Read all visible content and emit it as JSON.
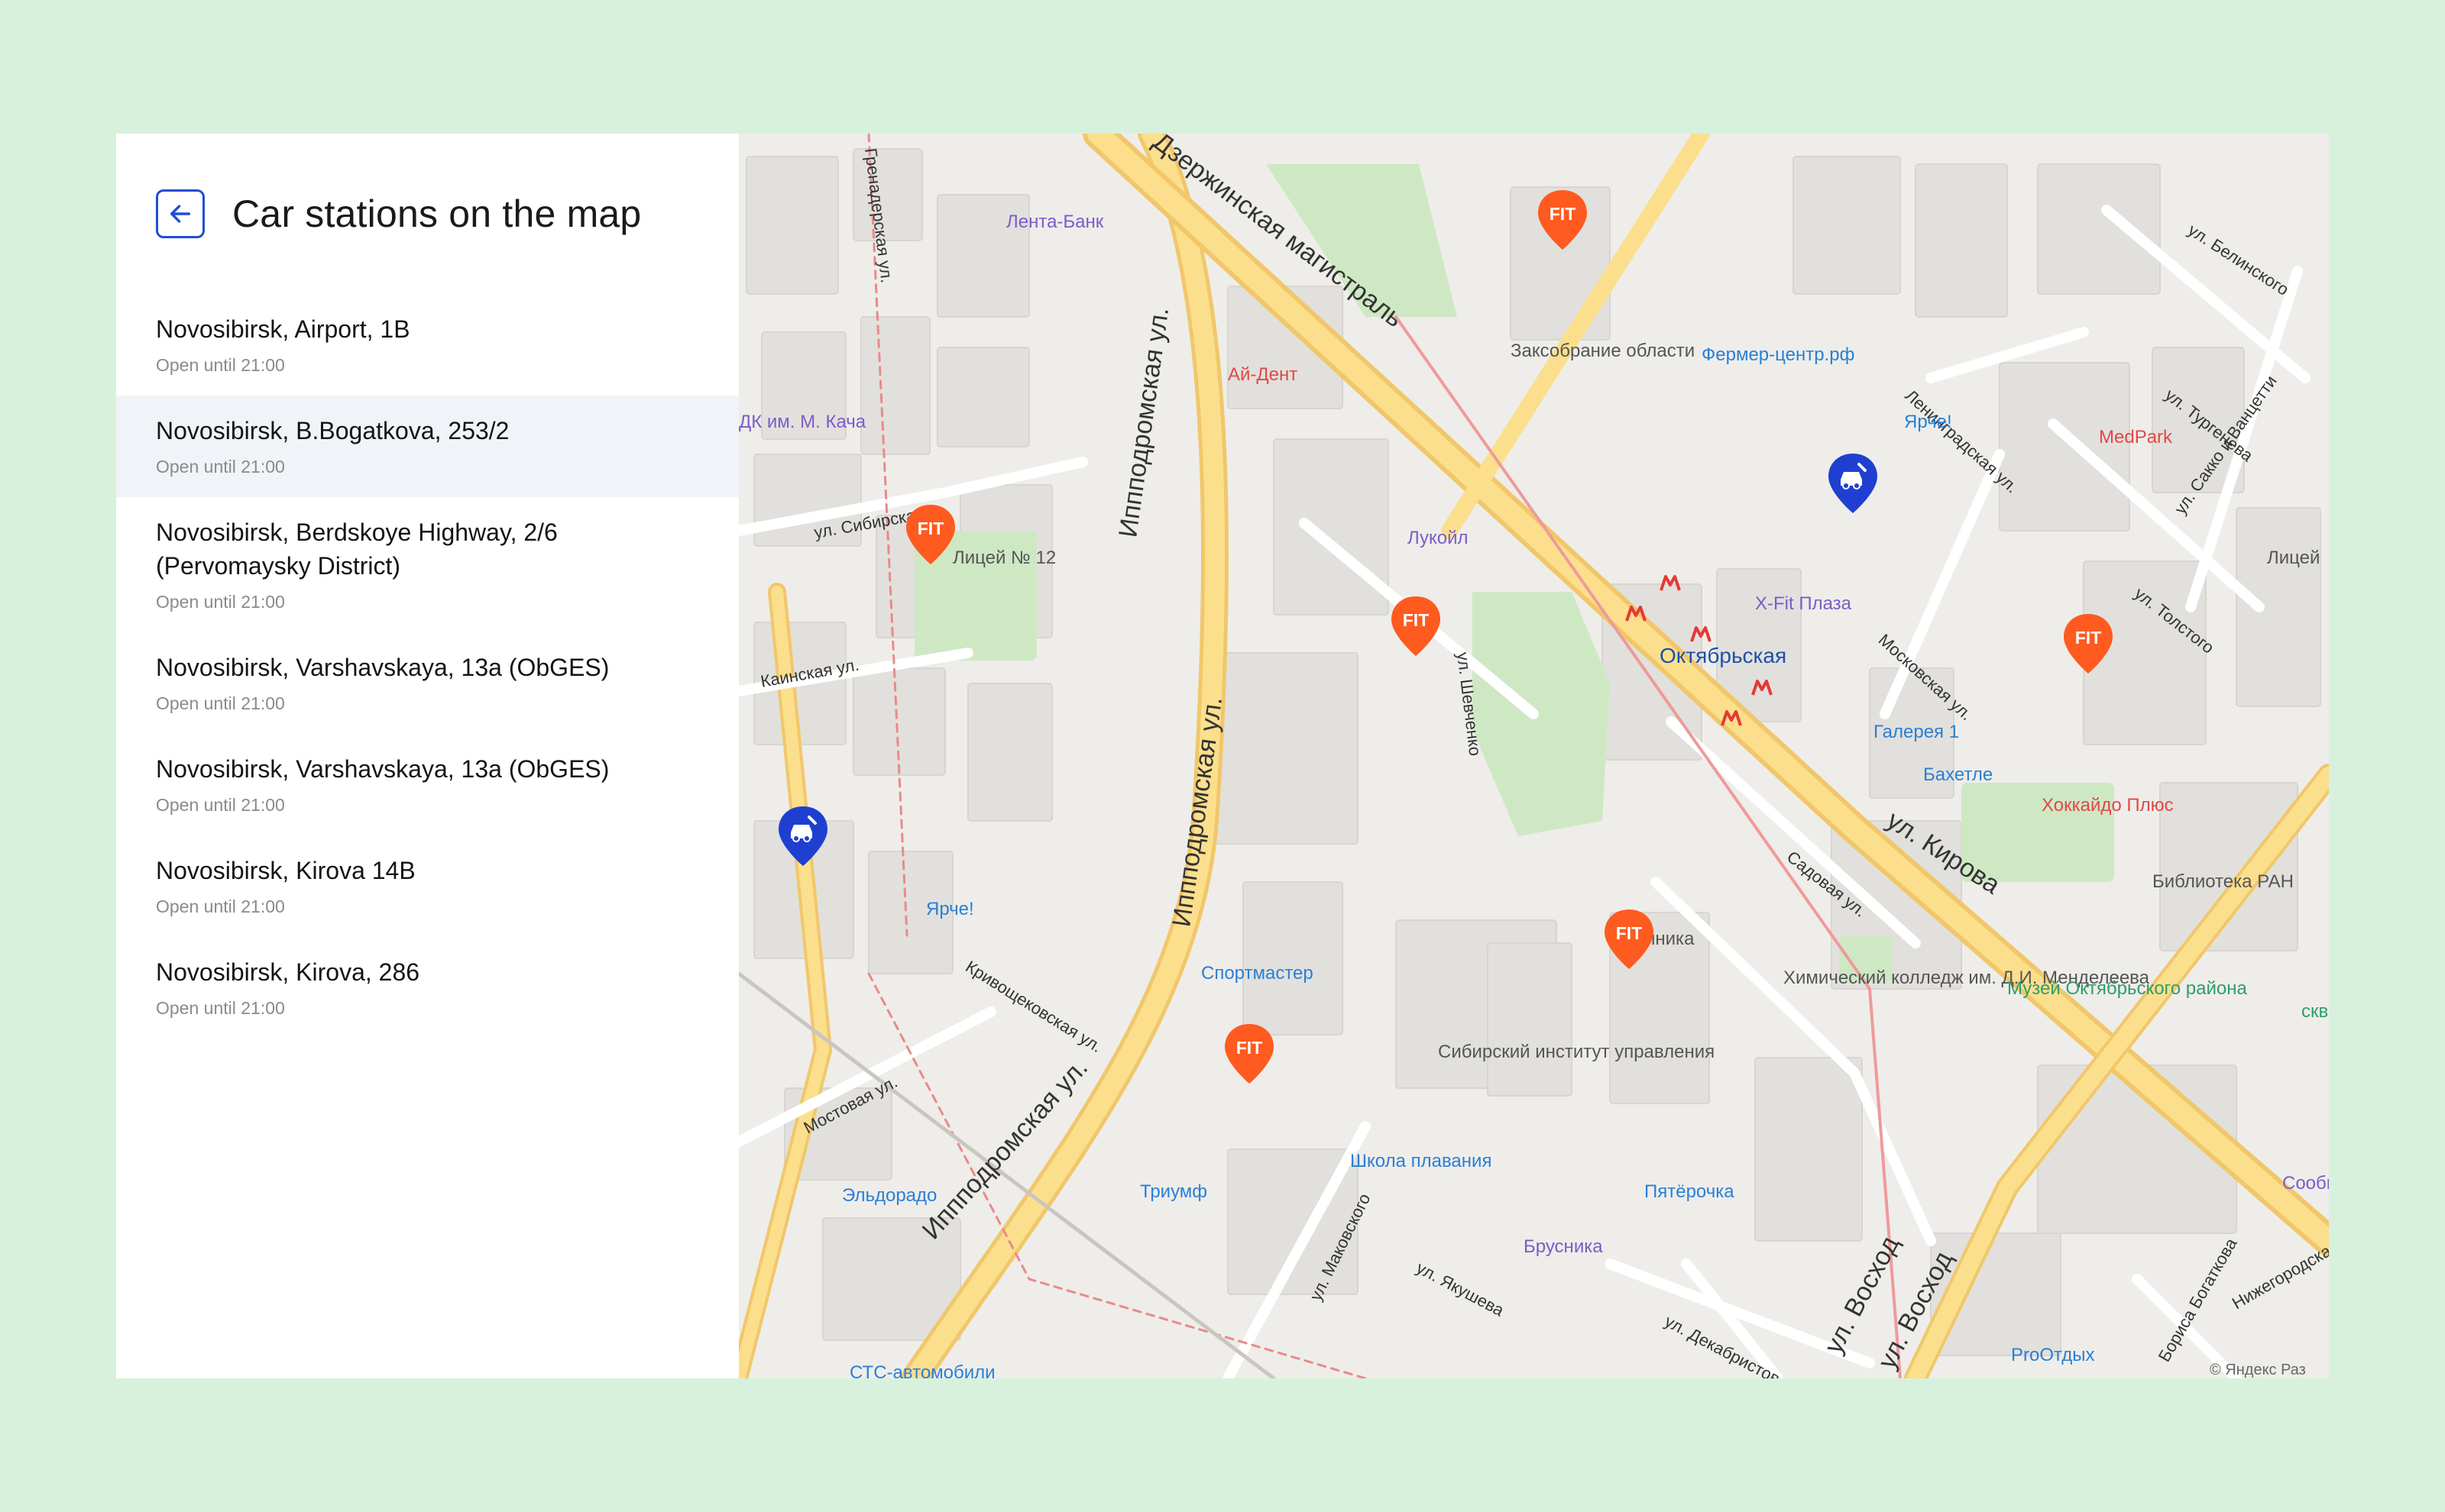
{
  "header": {
    "title": "Car stations on the map",
    "back_icon": "arrow-left-icon"
  },
  "stations": [
    {
      "name": "Novosibirsk, Airport, 1B",
      "hours": "Open until 21:00"
    },
    {
      "name": "Novosibirsk, B.Bogatkova, 253/2",
      "hours": "Open until 21:00",
      "selected": true
    },
    {
      "name": "Novosibirsk, Berdskoye Highway, 2/6 (Pervomaysky District)",
      "hours": "Open until 21:00"
    },
    {
      "name": "Novosibirsk, Varshavskaya, 13a (ObGES)",
      "hours": "Open until 21:00"
    },
    {
      "name": "Novosibirsk, Varshavskaya, 13a (ObGES)",
      "hours": "Open until 21:00"
    },
    {
      "name": "Novosibirsk, Kirova 14B",
      "hours": "Open until 21:00"
    },
    {
      "name": "Novosibirsk, Kirova, 286",
      "hours": "Open until 21:00"
    }
  ],
  "map": {
    "marker_label": "FIT",
    "colors": {
      "fit": "#ff5a1f",
      "service": "#1f3fd1",
      "accent": "#1f4fd1",
      "metro": "#e53935"
    },
    "streets": [
      "Иппподромская ул.",
      "Иппподромская ул.",
      "Иппподромская ул.",
      "ул. Кирова",
      "Ленинградская ул.",
      "Московская ул.",
      "Садовая ул.",
      "ул. Шевченко",
      "ул. Маковского",
      "ул. Якушева",
      "ул. Декабристов",
      "Мостовая ул.",
      "Кривощековская ул.",
      "Каинская ул.",
      "ул. Сибирская",
      "ул. Восход",
      "ул. Восход",
      "ул. Толстого",
      "ул. Тургенева",
      "ул. Белинского",
      "ул. Сакко и Ванцетти",
      "Бориса Богаткова",
      "Нижегородская",
      "Дзержинская магистраль",
      "Гренадерская ул."
    ],
    "pois": [
      "Лента-Банк",
      "Ай-Дент",
      "Заксобрание области",
      "Фермер-центр.рф",
      "Ярче!",
      "MedPark",
      "Лукойл",
      "X-Fit Плаза",
      "Октябрьская",
      "Галерея 1",
      "Бахетле",
      "Хоккайдо Плюс",
      "Библиотека РАН",
      "Лицей № 12",
      "Спортмастер",
      "Клиника",
      "Химический колледж им. Д.И. Менделеева",
      "Музей Октябрьского района",
      "сквер",
      "Сибирский институт управления",
      "Школа плавания",
      "Пятёрочка",
      "Триумф",
      "Брусника",
      "Эльдорадо",
      "ProОтдых",
      "СТС-автомобили",
      "ДК им. М. Кача",
      "Ярче!",
      "Лицей",
      "Сообщение"
    ],
    "copyright": "© Яндекс  Раз"
  }
}
